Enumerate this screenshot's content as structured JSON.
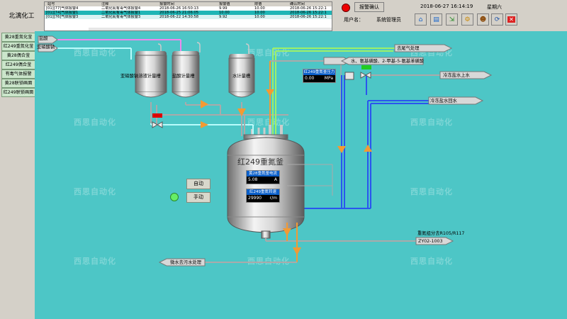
{
  "header": {
    "company": "北漓化工",
    "alarm_table": {
      "columns": [
        "站号",
        "注释",
        "报警时间",
        "报警值",
        "限值",
        "确认时间"
      ],
      "rows": [
        [
          "[01][77]气体报警4",
          "二氧化氮有毒气体报警4",
          "2018-06-26 16:50:13",
          "9.99",
          "10.00",
          "2018-06-26 15:22:1"
        ],
        [
          "[01][74]气体报警1",
          "二氧化氮有毒气体报警1",
          "2018-06-25 21:06:05",
          "10.00",
          "10.00",
          "2018-06-26 15:22:1"
        ],
        [
          "[01][76]气体报警3",
          "二氧化氮有毒气体报警3",
          "2018-06-22 14:30:58",
          "9.92",
          "10.00",
          "2018-06-26 15:22:1"
        ]
      ]
    },
    "ack_button": "报警确认",
    "datetime": "2018-06-27 16:14:19",
    "weekday": "星期六",
    "user_label": "用户名：",
    "user_name": "系统管理员"
  },
  "nav": {
    "items": [
      "黄28重氮化釜",
      "红249重氮化釜",
      "黄28偶合釜",
      "红249偶合釜",
      "有毒气体报警",
      "黄28联锁画面",
      "红249联锁画面"
    ]
  },
  "process": {
    "labels": {
      "hcl": "盐酸",
      "nitrite": "亚硝酸钠",
      "tank1": "亚硝酸钠溶液计量槽",
      "tank2": "盐酸计量槽",
      "tank3": "水计量槽",
      "exhaust": "去尾气处理",
      "feed": "水、氨基磺酸、2-甲基-5-氨基苯磺酸",
      "brine_in": "冷冻盐水上水",
      "brine_out": "冷冻盐水回水",
      "reactor": "红249重氮釜",
      "product": "重氮组分去R105/R117",
      "product_tag": "ZY02-1003",
      "wastewater": "微水去污水处理"
    },
    "pressure": {
      "label": "红249重氮釜压力",
      "value": "0.00",
      "unit": "MPa"
    },
    "current": {
      "label": "黄28重氮釜电流",
      "value": "5.08",
      "unit": "A"
    },
    "speed": {
      "label": "红249重氮转速",
      "value": "29990",
      "unit": "r/m"
    },
    "buttons": {
      "auto": "自动",
      "manual": "手动"
    },
    "watermark": "西思自动化"
  },
  "colors": {
    "background": "#4dc6c6",
    "pipe_grey": "#aaaaaa",
    "pipe_cyan": "#b9fbfb",
    "pipe_pink": "#ee88ee",
    "pipe_green": "#9cf06a",
    "pipe_blue": "#2a55ee",
    "flow_arrow": "#f39a33",
    "valve_open": "#22cc22",
    "valve_closed": "#dd0000",
    "status_lamp": "#66ee66"
  }
}
